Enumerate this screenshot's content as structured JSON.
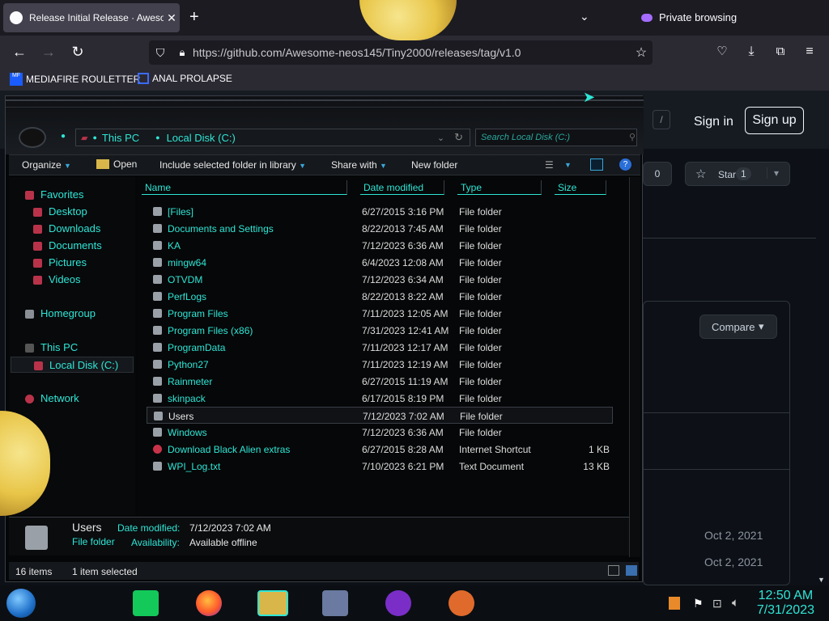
{
  "browser": {
    "tab_title": "Release Initial Release · Awesom",
    "close_tab": "✕",
    "new_tab": "+",
    "private_label": "Private browsing",
    "url": "https://github.com/Awesome-neos145/Tiny2000/releases/tag/v1.0",
    "bookmarks": [
      "MEDIAFIRE ROULETTER",
      "ANAL PROLAPSE"
    ]
  },
  "github": {
    "sign_in": "Sign in",
    "sign_up": "Sign up",
    "star_label": "Star",
    "star_count": "1",
    "fork_count": "0",
    "compare_label": "Compare",
    "dates": [
      "Oct 2, 2021",
      "Oct 2, 2021"
    ]
  },
  "explorer": {
    "breadcrumb": [
      "This PC",
      "Local Disk (C:)"
    ],
    "search_placeholder": "Search Local Disk (C:)",
    "commands": {
      "organize": "Organize",
      "open": "Open",
      "include": "Include selected folder in library",
      "share": "Share with",
      "new_folder": "New folder"
    },
    "nav": {
      "favorites": "Favorites",
      "desktop": "Desktop",
      "downloads": "Downloads",
      "documents": "Documents",
      "pictures": "Pictures",
      "videos": "Videos",
      "homegroup": "Homegroup",
      "this_pc": "This PC",
      "local_disk": "Local Disk (C:)",
      "network": "Network"
    },
    "columns": [
      "Name",
      "Date modified",
      "Type",
      "Size"
    ],
    "rows": [
      {
        "name": "[Files]",
        "date": "6/27/2015 3:16 PM",
        "type": "File folder",
        "size": ""
      },
      {
        "name": "Documents and Settings",
        "date": "8/22/2013 7:45 AM",
        "type": "File folder",
        "size": ""
      },
      {
        "name": "KA",
        "date": "7/12/2023 6:36 AM",
        "type": "File folder",
        "size": ""
      },
      {
        "name": "mingw64",
        "date": "6/4/2023 12:08 AM",
        "type": "File folder",
        "size": ""
      },
      {
        "name": "OTVDM",
        "date": "7/12/2023 6:34 AM",
        "type": "File folder",
        "size": ""
      },
      {
        "name": "PerfLogs",
        "date": "8/22/2013 8:22 AM",
        "type": "File folder",
        "size": ""
      },
      {
        "name": "Program Files",
        "date": "7/11/2023 12:05 AM",
        "type": "File folder",
        "size": ""
      },
      {
        "name": "Program Files (x86)",
        "date": "7/31/2023 12:41 AM",
        "type": "File folder",
        "size": ""
      },
      {
        "name": "ProgramData",
        "date": "7/11/2023 12:17 AM",
        "type": "File folder",
        "size": ""
      },
      {
        "name": "Python27",
        "date": "7/11/2023 12:19 AM",
        "type": "File folder",
        "size": ""
      },
      {
        "name": "Rainmeter",
        "date": "6/27/2015 11:19 AM",
        "type": "File folder",
        "size": ""
      },
      {
        "name": "skinpack",
        "date": "6/17/2015 8:19 PM",
        "type": "File folder",
        "size": ""
      },
      {
        "name": "Users",
        "date": "7/12/2023 7:02 AM",
        "type": "File folder",
        "size": ""
      },
      {
        "name": "Windows",
        "date": "7/12/2023 6:36 AM",
        "type": "File folder",
        "size": ""
      },
      {
        "name": "Download Black Alien extras",
        "date": "6/27/2015 8:28 AM",
        "type": "Internet Shortcut",
        "size": "1 KB"
      },
      {
        "name": "WPI_Log.txt",
        "date": "7/10/2023 6:21 PM",
        "type": "Text Document",
        "size": "13 KB"
      }
    ],
    "selected_row": 12,
    "details": {
      "name": "Users",
      "kind": "File folder",
      "date_label": "Date modified:",
      "date_value": "7/12/2023 7:02 AM",
      "avail_label": "Availability:",
      "avail_value": "Available offline"
    },
    "status": {
      "items": "16 items",
      "selected": "1 item selected"
    }
  },
  "taskbar": {
    "time": "12:50 AM",
    "date": "7/31/2023"
  }
}
